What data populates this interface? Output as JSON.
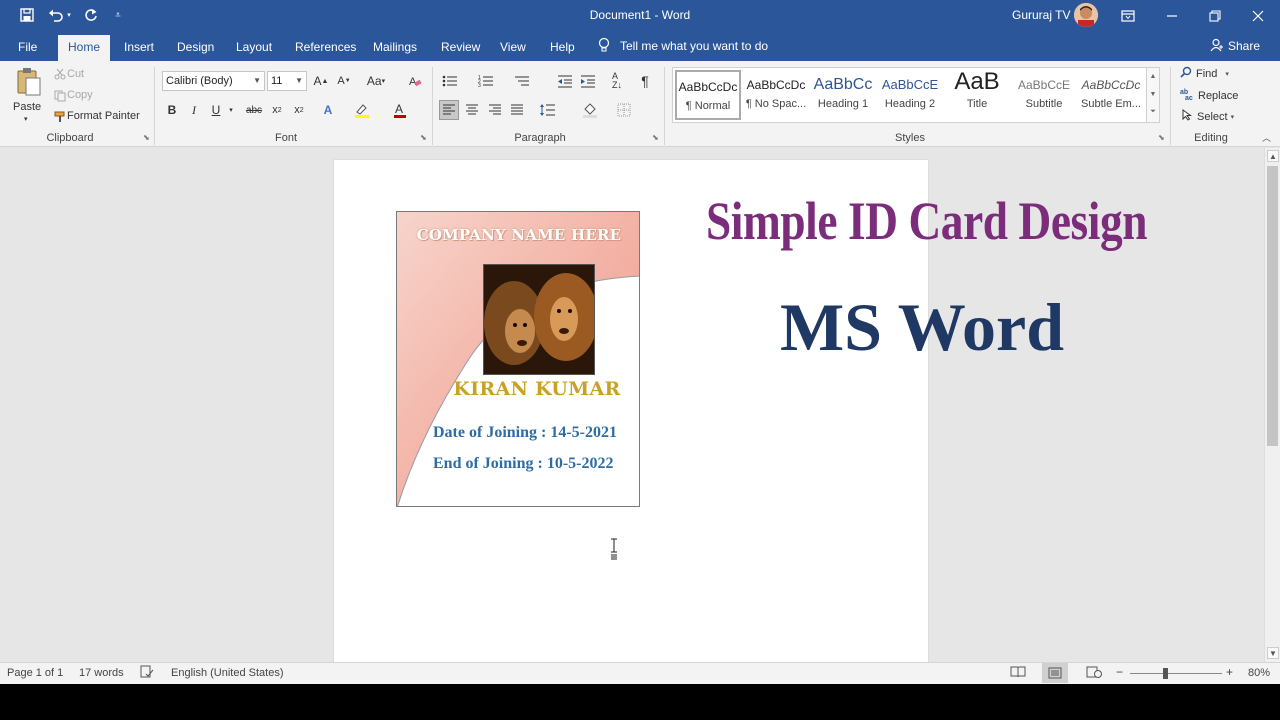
{
  "window": {
    "doc_title": "Document1  -  Word",
    "user_name": "Gururaj TV"
  },
  "tabs": [
    {
      "label": "File"
    },
    {
      "label": "Home"
    },
    {
      "label": "Insert"
    },
    {
      "label": "Design"
    },
    {
      "label": "Layout"
    },
    {
      "label": "References"
    },
    {
      "label": "Mailings"
    },
    {
      "label": "Review"
    },
    {
      "label": "View"
    },
    {
      "label": "Help"
    }
  ],
  "active_tab": "Home",
  "tell_me": "Tell me what you want to do",
  "share_label": "Share",
  "clipboard": {
    "paste": "Paste",
    "cut": "Cut",
    "copy": "Copy",
    "format_painter": "Format Painter",
    "label": "Clipboard"
  },
  "font": {
    "family": "Calibri (Body)",
    "size": "11",
    "label": "Font"
  },
  "paragraph": {
    "label": "Paragraph"
  },
  "styles": {
    "label": "Styles",
    "items": [
      {
        "sample": "AaBbCcDc",
        "name": "¶ Normal"
      },
      {
        "sample": "AaBbCcDc",
        "name": "¶ No Spac..."
      },
      {
        "sample": "AaBbCc",
        "name": "Heading 1"
      },
      {
        "sample": "AaBbCcE",
        "name": "Heading 2"
      },
      {
        "sample": "AaB",
        "name": "Title"
      },
      {
        "sample": "AaBbCcE",
        "name": "Subtitle"
      },
      {
        "sample": "AaBbCcDc",
        "name": "Subtle Em..."
      }
    ]
  },
  "editing": {
    "find": "Find",
    "replace": "Replace",
    "select": "Select",
    "label": "Editing"
  },
  "document": {
    "card": {
      "company": "COMPANY NAME HERE",
      "person": "KIRAN KUMAR",
      "joining": "Date of Joining : 14-5-2021",
      "end": "End of Joining : 10-5-2022"
    },
    "title": "Simple ID Card Design",
    "subtitle": "MS Word"
  },
  "status": {
    "page": "Page 1 of 1",
    "words": "17 words",
    "language": "English (United States)",
    "zoom": "80%"
  },
  "colors": {
    "brand": "#2b579a",
    "title_purple": "#7b2c7a",
    "subtitle_navy": "#1f3864",
    "name_gold": "#c8a225",
    "info_blue": "#2e6da4",
    "card_pink": "#f2a89b"
  }
}
